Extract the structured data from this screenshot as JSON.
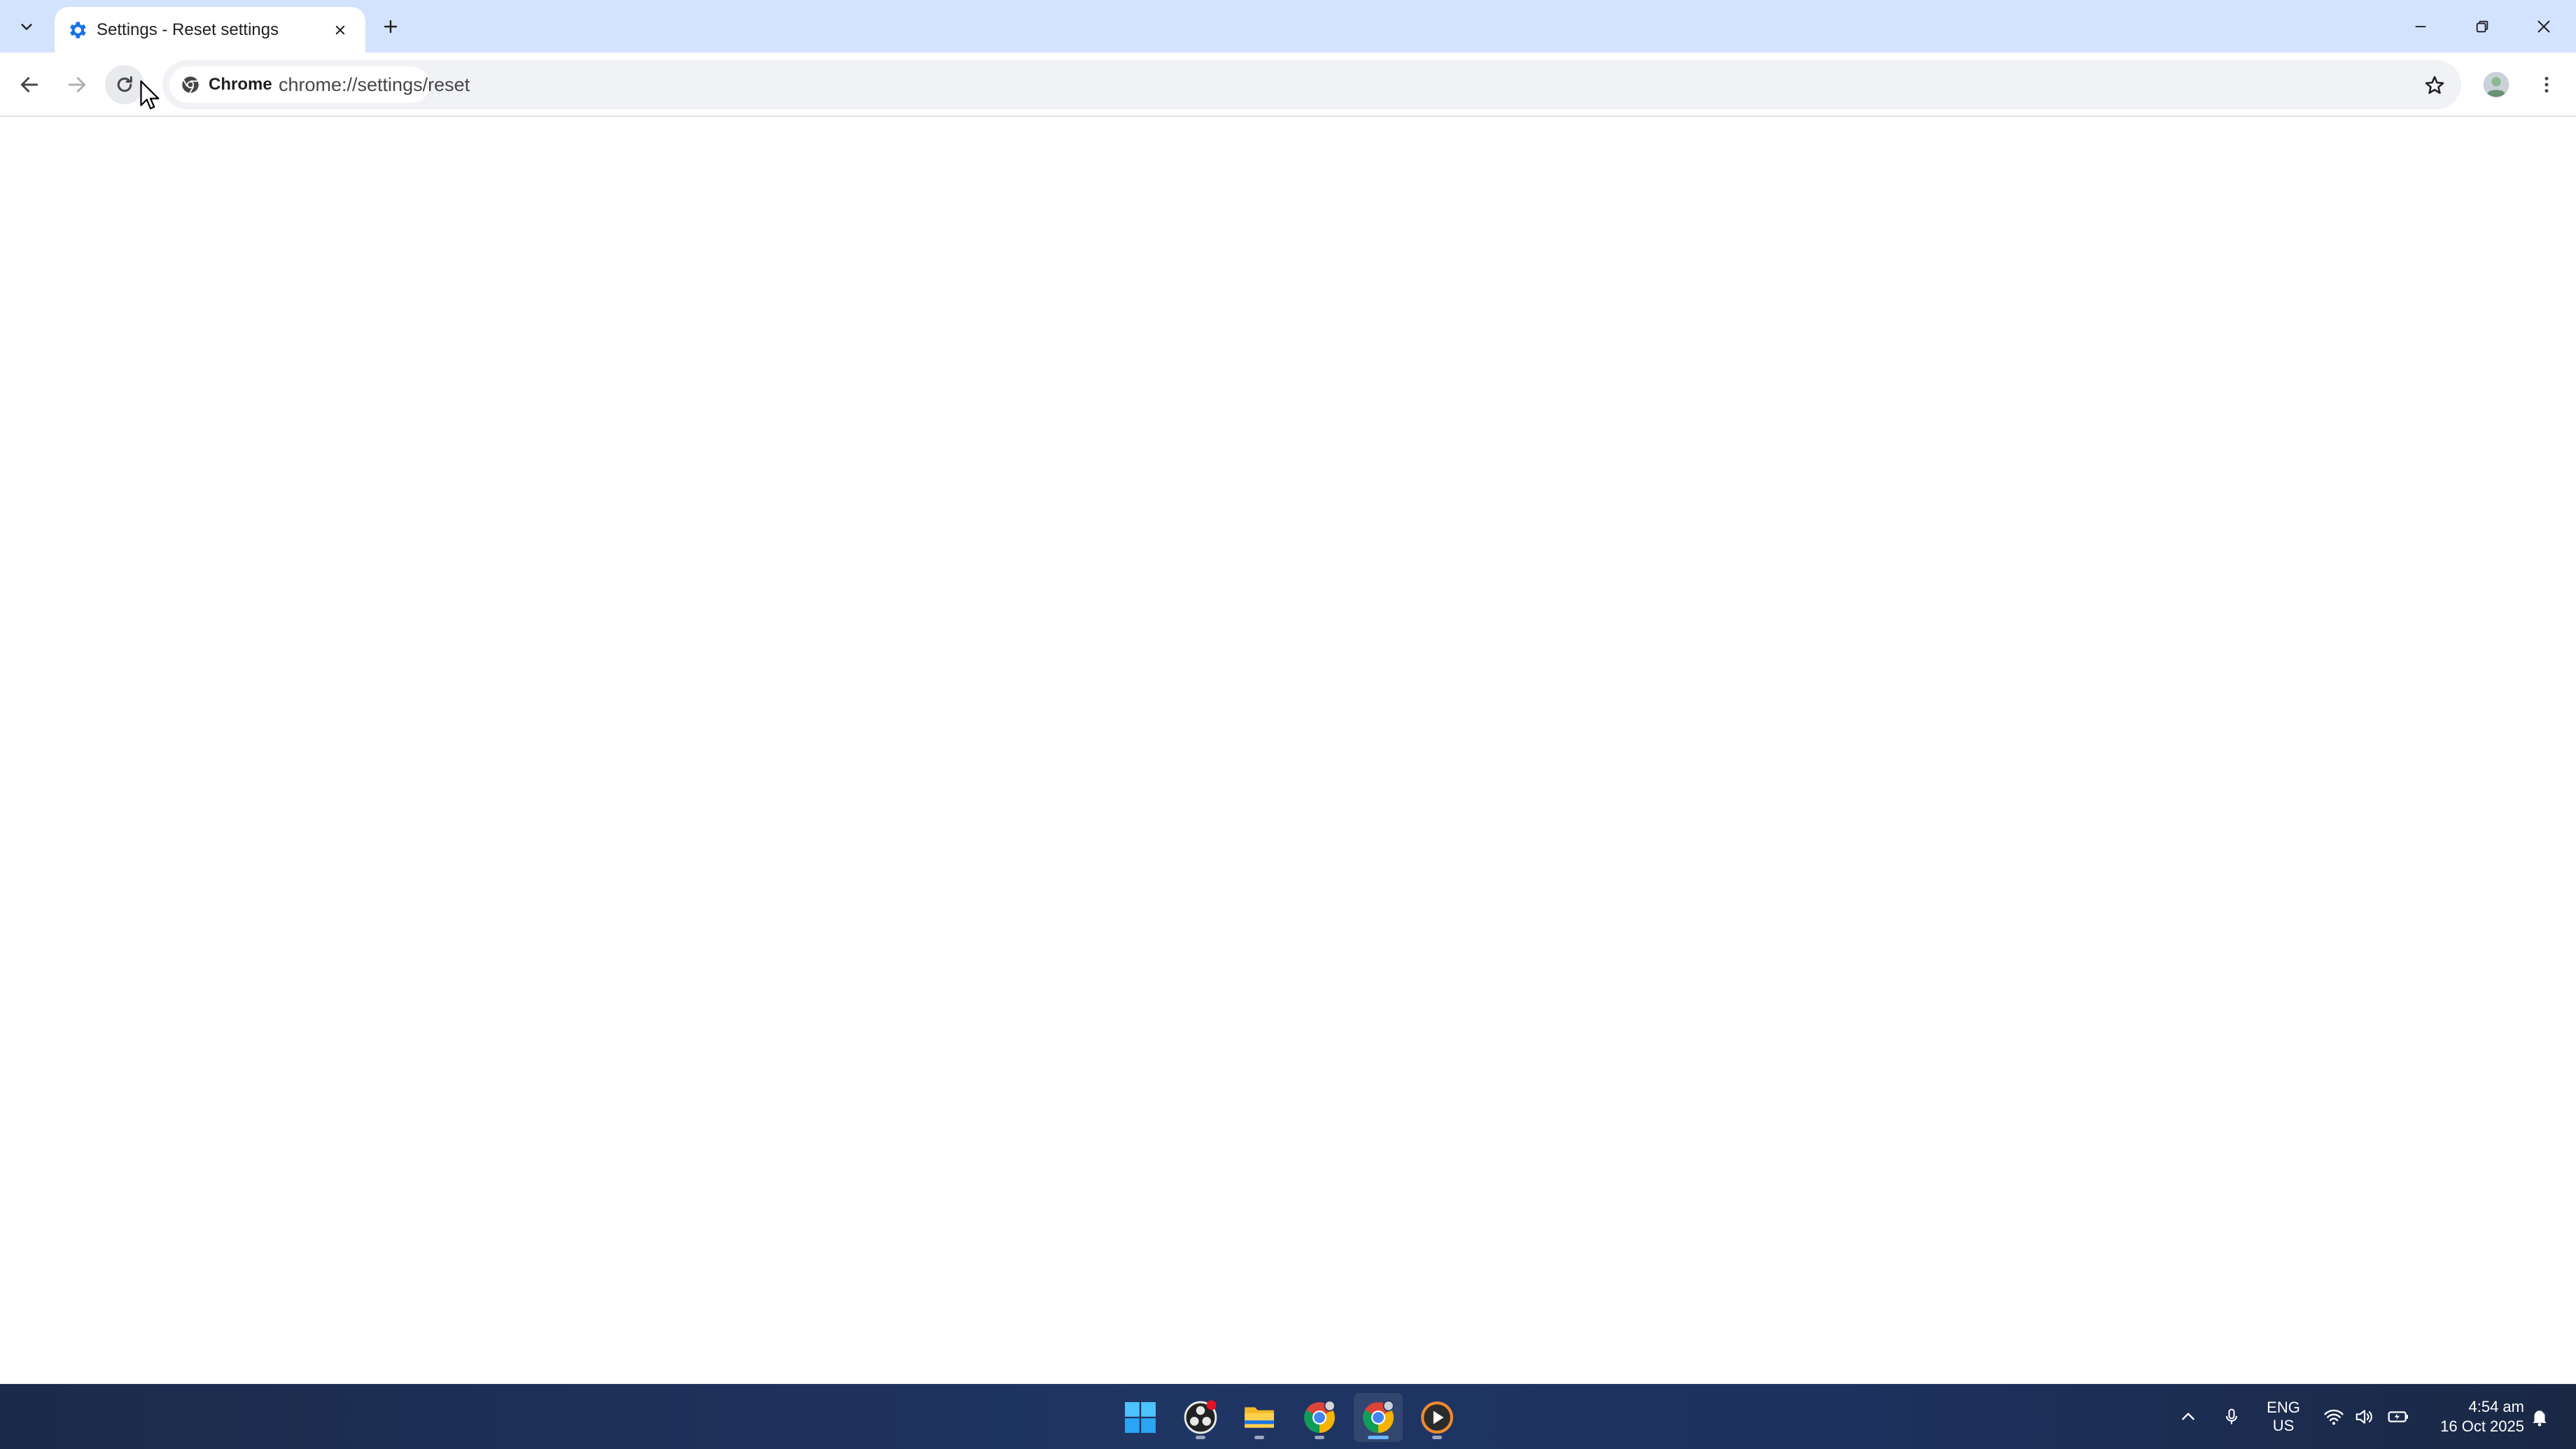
{
  "browser": {
    "tab": {
      "title": "Settings - Reset settings",
      "favicon": "gear-icon"
    },
    "toolbar": {
      "chip_label": "Chrome",
      "url": "chrome://settings/reset"
    },
    "colors": {
      "tabstrip_bg": "#d3e3fd",
      "accent_blue": "#1a73e8",
      "omnibox_bg": "#f0f2f5"
    }
  },
  "taskbar": {
    "apps": [
      {
        "name": "start-button",
        "icon": "windows-icon"
      },
      {
        "name": "app-obs",
        "icon": "obs-icon",
        "badge": true
      },
      {
        "name": "app-file-explorer",
        "icon": "folder-icon"
      },
      {
        "name": "app-chrome",
        "icon": "chrome-icon"
      },
      {
        "name": "app-chrome-profile",
        "icon": "chrome-icon",
        "active": true
      },
      {
        "name": "app-media-player",
        "icon": "play-icon"
      }
    ],
    "tray": {
      "lang_top": "ENG",
      "lang_bottom": "US"
    },
    "clock": {
      "time": "4:54 am",
      "date": "16 Oct 2025"
    }
  }
}
